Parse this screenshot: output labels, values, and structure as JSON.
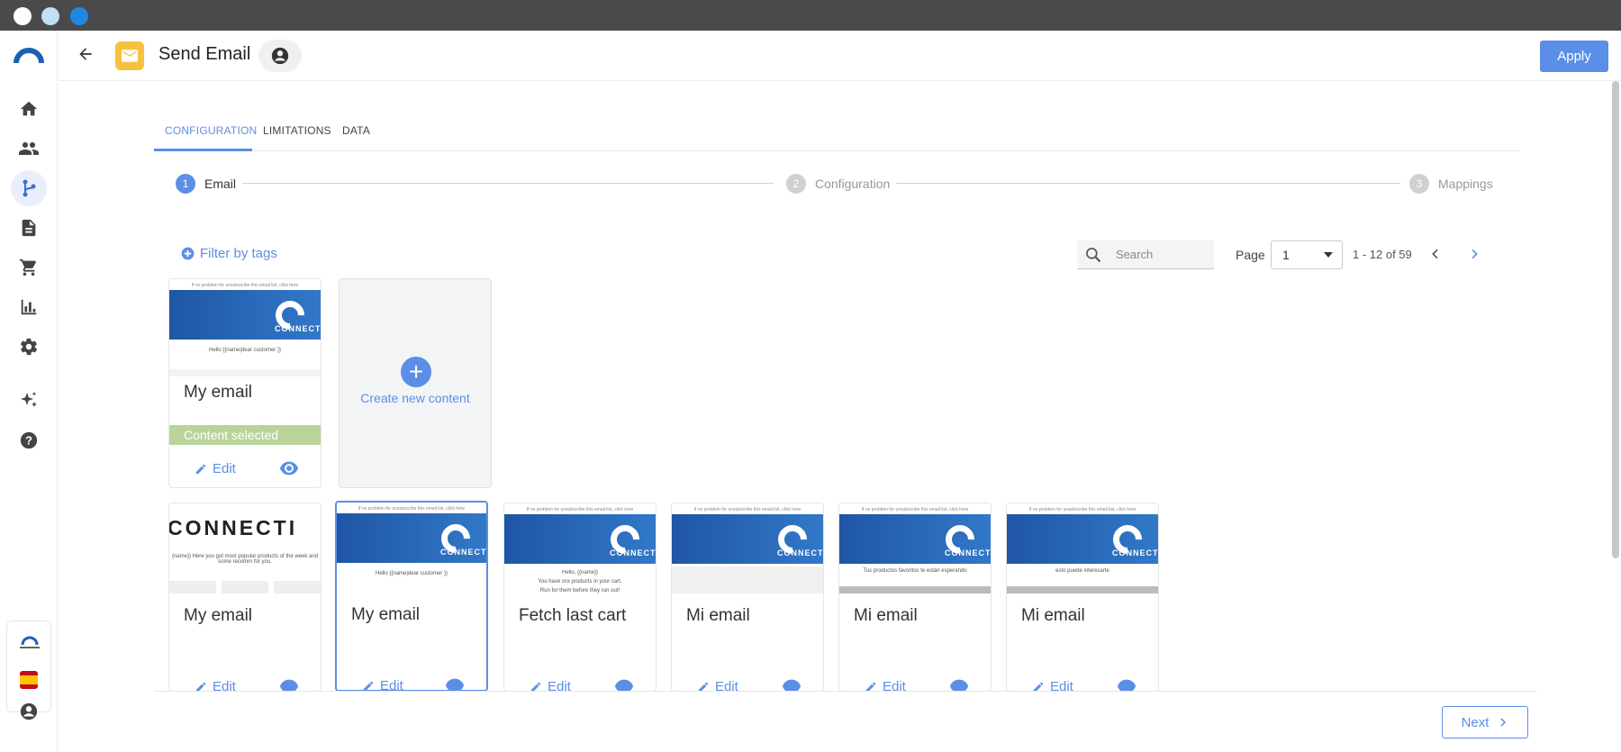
{
  "header": {
    "title": "Send Email",
    "apply_label": "Apply"
  },
  "tabs": [
    {
      "label": "CONFIGURATION"
    },
    {
      "label": "LIMITATIONS"
    },
    {
      "label": "DATA"
    }
  ],
  "stepper": [
    {
      "num": "1",
      "label": "Email"
    },
    {
      "num": "2",
      "label": "Configuration"
    },
    {
      "num": "3",
      "label": "Mappings"
    }
  ],
  "toolbar": {
    "filter_label": "Filter by tags",
    "search_placeholder": "Search",
    "page_label": "Page",
    "page_value": "1",
    "range": "1 - 12 of 59"
  },
  "cards": [
    {
      "name": "My email",
      "greeting": "Hello {{name|dear customer }}",
      "status": "Content selected",
      "edit": "Edit"
    },
    {
      "name": "My email",
      "preview_word": "CONNECTI",
      "preview_text": "{name}} Here you got most popular products of the week and some recomm for you.",
      "edit": "Edit"
    },
    {
      "name": "My email",
      "greeting": "Hello {{name|dear customer }}",
      "edit": "Edit"
    },
    {
      "name": "Fetch last cart",
      "greeting": "Hello, {{name}}",
      "line2": "You have xxx products in your cart.",
      "line3": "Run for them before they run out!",
      "edit": "Edit"
    },
    {
      "name": "Mi email",
      "edit": "Edit"
    },
    {
      "name": "Mi email",
      "greeting": "Tus productos favoritos te están esperando",
      "edit": "Edit"
    },
    {
      "name": "Mi email",
      "greeting": "esto puede interesarte",
      "edit": "Edit"
    }
  ],
  "create": {
    "label": "Create new content"
  },
  "preview_header": "If no problem for unsubscribe this email list, click here",
  "brand_word": "CONNECTI",
  "footer": {
    "next_label": "Next"
  },
  "colors": {
    "accent": "#5b8ee6",
    "selected_band": "#b9d49a",
    "banner": "#1f56a5"
  }
}
